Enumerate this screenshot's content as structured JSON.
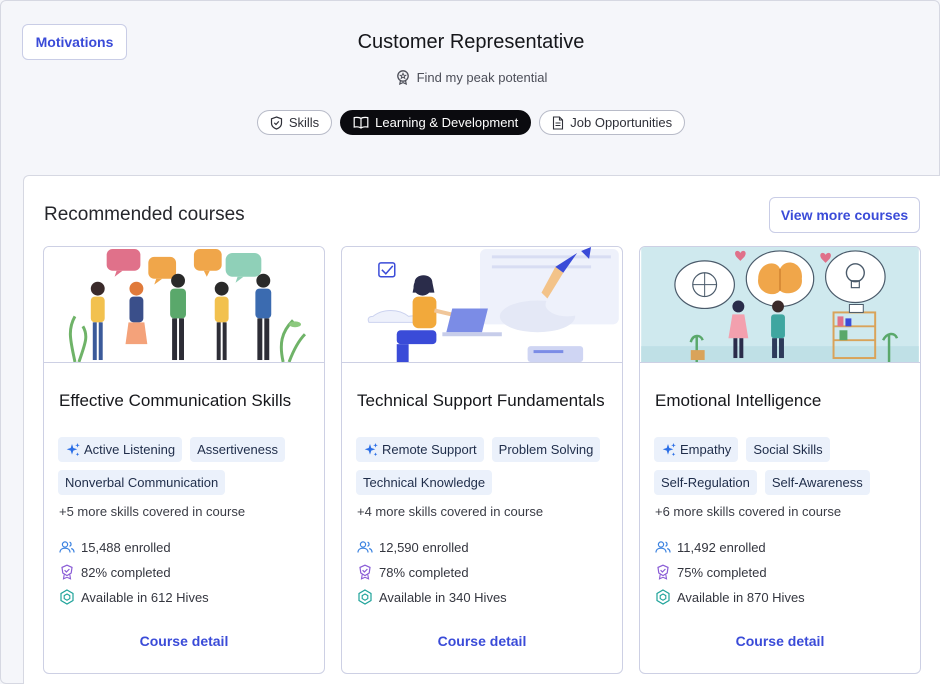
{
  "header": {
    "motivations_label": "Motivations",
    "role_title": "Customer Representative",
    "peak_label": "Find my peak potential"
  },
  "tabs": [
    {
      "label": "Skills",
      "icon": "shield-icon",
      "active": false
    },
    {
      "label": "Learning & Development",
      "icon": "book-icon",
      "active": true
    },
    {
      "label": "Job Opportunities",
      "icon": "document-icon",
      "active": false
    }
  ],
  "section": {
    "title": "Recommended courses",
    "view_more_label": "View more courses"
  },
  "courses": [
    {
      "title": "Effective Communication Skills",
      "skills": [
        "Active Listening",
        "Assertiveness",
        "Nonverbal Communication"
      ],
      "more_skills": "+5 more skills covered in course",
      "enrolled": "15,488 enrolled",
      "completed": "82% completed",
      "hives": "Available in 612 Hives",
      "detail_label": "Course detail"
    },
    {
      "title": "Technical Support Fundamentals",
      "skills": [
        "Remote Support",
        "Problem Solving",
        "Technical Knowledge"
      ],
      "more_skills": "+4 more skills covered in course",
      "enrolled": "12,590 enrolled",
      "completed": "78% completed",
      "hives": "Available in 340 Hives",
      "detail_label": "Course detail"
    },
    {
      "title": "Emotional Intelligence",
      "skills": [
        "Empathy",
        "Social Skills",
        "Self-Regulation",
        "Self-Awareness"
      ],
      "more_skills": "+6 more skills covered in course",
      "enrolled": "11,492 enrolled",
      "completed": "75% completed",
      "hives": "Available in 870 Hives",
      "detail_label": "Course detail"
    }
  ],
  "colors": {
    "accent": "#3a4bd8",
    "chip_bg": "#ebf1fb",
    "sparkle": "#2c6fe6",
    "enrolled_icon": "#3b82e0",
    "completed_icon": "#8a5cd6",
    "hives_icon": "#1fa39a"
  }
}
